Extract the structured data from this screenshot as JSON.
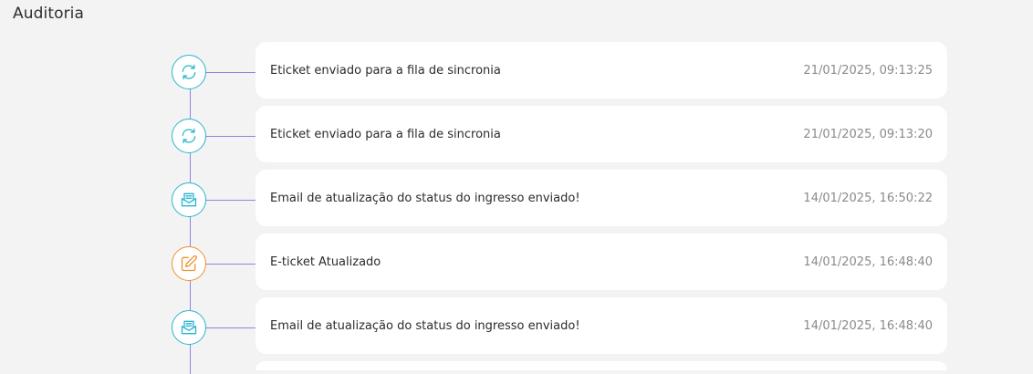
{
  "page": {
    "title": "Auditoria"
  },
  "colors": {
    "background": "#f3f3f3",
    "card": "#ffffff",
    "timeline": "#8b86e0",
    "teal_icon": "#29b6d0",
    "orange_icon": "#f0922e",
    "timestamp": "#8a8a8a"
  },
  "timeline": {
    "entries": [
      {
        "icon": "sync-icon",
        "icon_color": "teal",
        "text": "Eticket enviado para a fila de sincronia",
        "timestamp": "21/01/2025, 09:13:25"
      },
      {
        "icon": "sync-icon",
        "icon_color": "teal",
        "text": "Eticket enviado para a fila de sincronia",
        "timestamp": "21/01/2025, 09:13:20"
      },
      {
        "icon": "email-icon",
        "icon_color": "teal",
        "text": "Email de atualização do status do ingresso enviado!",
        "timestamp": "14/01/2025, 16:50:22"
      },
      {
        "icon": "edit-icon",
        "icon_color": "orange",
        "text": "E-ticket Atualizado",
        "timestamp": "14/01/2025, 16:48:40"
      },
      {
        "icon": "email-icon",
        "icon_color": "teal",
        "text": "Email de atualização do status do ingresso enviado!",
        "timestamp": "14/01/2025, 16:48:40"
      }
    ]
  }
}
